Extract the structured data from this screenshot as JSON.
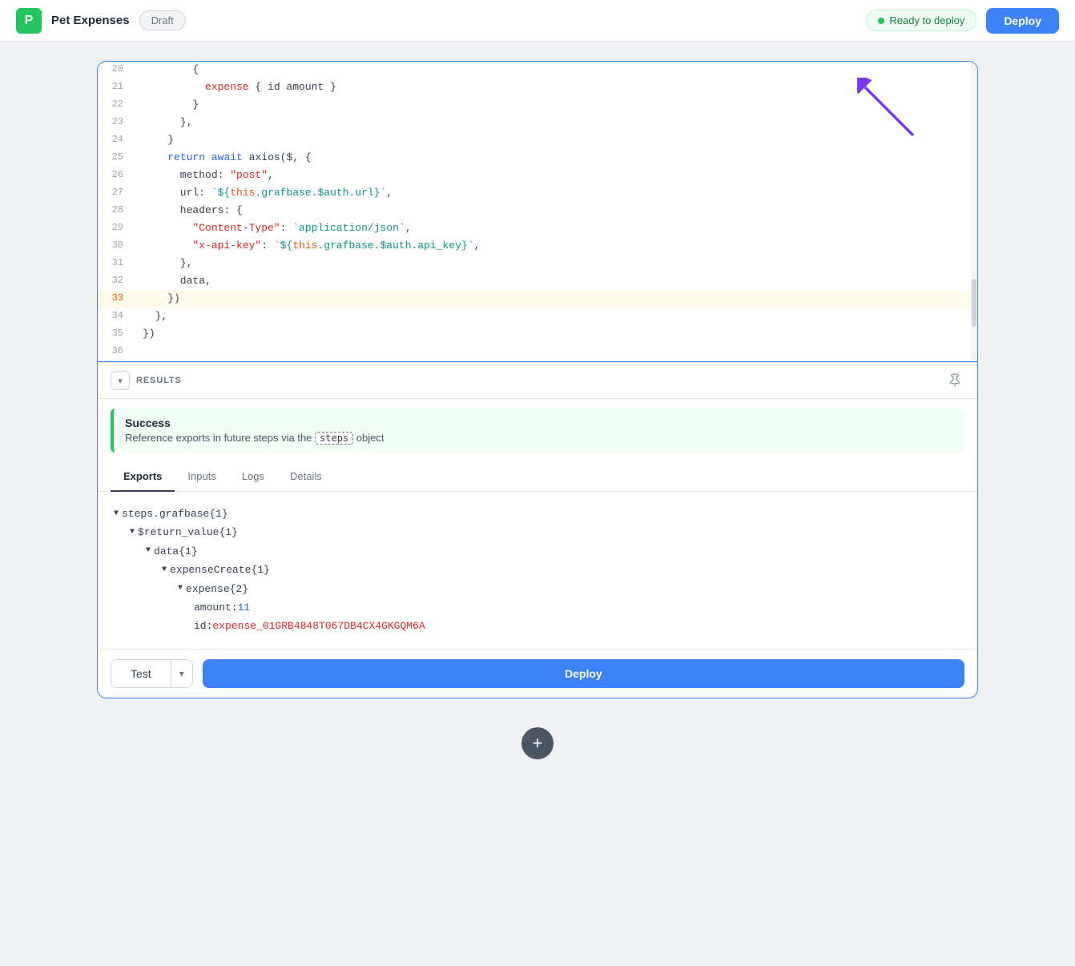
{
  "navbar": {
    "logo_letter": "P",
    "app_name": "Pet Expenses",
    "draft_label": "Draft",
    "ready_label": "Ready to deploy",
    "deploy_label": "Deploy"
  },
  "editor": {
    "lines": [
      {
        "num": 20,
        "content": "        {",
        "highlight": false
      },
      {
        "num": 21,
        "content": "          expense { id amount }",
        "highlight": false,
        "parts": [
          {
            "text": "          expense { ",
            "color": "plain"
          },
          {
            "text": "id amount",
            "color": "plain"
          },
          {
            "text": " }",
            "color": "plain"
          }
        ]
      },
      {
        "num": 22,
        "content": "        }",
        "highlight": false
      },
      {
        "num": 23,
        "content": "      },",
        "highlight": false
      },
      {
        "num": 24,
        "content": "    }",
        "highlight": false
      },
      {
        "num": 25,
        "content": "    return await axios($, {",
        "highlight": false
      },
      {
        "num": 26,
        "content": "      method: \"post\",",
        "highlight": false
      },
      {
        "num": 27,
        "content": "      url: `${this.grafbase.$auth.url}`,",
        "highlight": false
      },
      {
        "num": 28,
        "content": "      headers: {",
        "highlight": false
      },
      {
        "num": 29,
        "content": "        \"Content-Type\": `application/json`,",
        "highlight": false
      },
      {
        "num": 30,
        "content": "        \"x-api-key\": `${this.grafbase.$auth.api_key}`,",
        "highlight": false
      },
      {
        "num": 31,
        "content": "      },",
        "highlight": false
      },
      {
        "num": 32,
        "content": "      data,",
        "highlight": false
      },
      {
        "num": 33,
        "content": "    })",
        "highlight": true
      },
      {
        "num": 34,
        "content": "  },",
        "highlight": false
      },
      {
        "num": 35,
        "content": "})",
        "highlight": false
      },
      {
        "num": 36,
        "content": "",
        "highlight": false
      }
    ]
  },
  "results": {
    "header_label": "RESULTS",
    "success_title": "Success",
    "success_desc": "Reference exports in future steps via the",
    "steps_badge": "steps",
    "steps_suffix": "object",
    "tabs": [
      "Exports",
      "Inputs",
      "Logs",
      "Details"
    ],
    "active_tab": "Exports",
    "tree": [
      {
        "indent": 0,
        "text": "▼steps.grafbase {1}",
        "key": "steps.grafbase",
        "count": "{1}"
      },
      {
        "indent": 1,
        "text": "▼$return_value {1}",
        "key": "$return_value",
        "count": "{1}"
      },
      {
        "indent": 2,
        "text": "▼data {1}",
        "key": "data",
        "count": "{1}"
      },
      {
        "indent": 3,
        "text": "▼expenseCreate {1}",
        "key": "expenseCreate",
        "count": "{1}"
      },
      {
        "indent": 4,
        "text": "▼expense {2}",
        "key": "expense",
        "count": "{2}"
      },
      {
        "indent": 5,
        "key_only": "amount",
        "value": "11",
        "value_type": "num"
      },
      {
        "indent": 5,
        "key_only": "id",
        "value": "expense_01GRB4848T067DB4CX4GKGQM6A",
        "value_type": "str"
      }
    ]
  },
  "bottom_bar": {
    "test_label": "Test",
    "deploy_label": "Deploy"
  },
  "plus_btn": "+"
}
